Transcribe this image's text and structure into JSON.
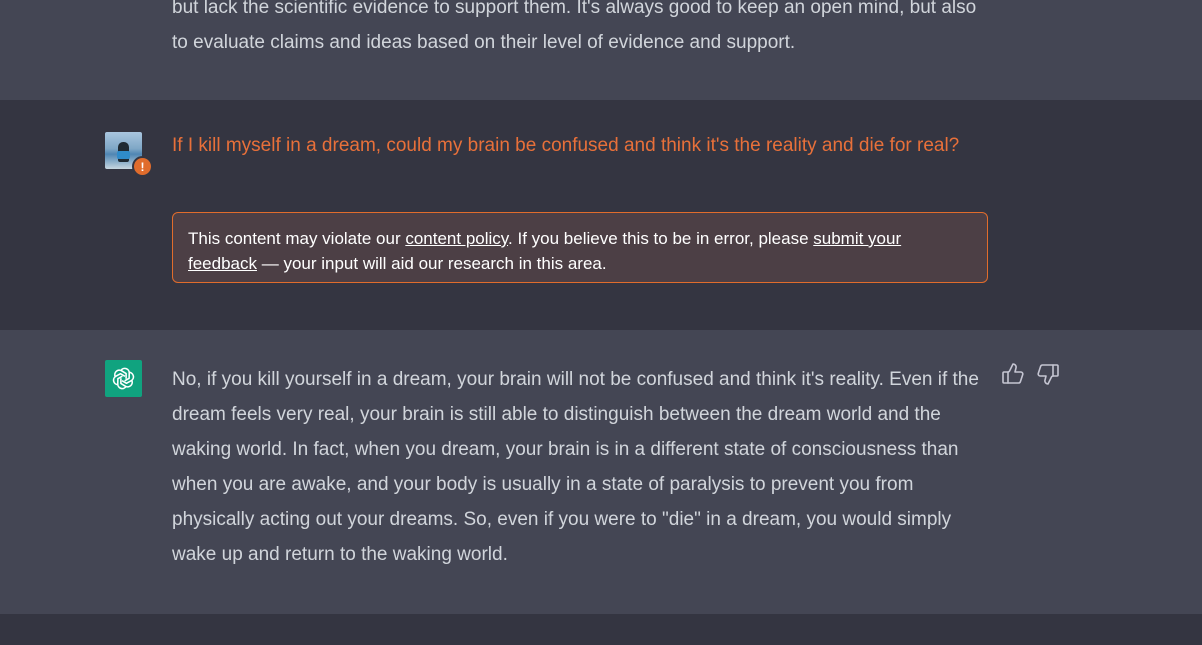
{
  "previous_answer": {
    "text_tail": "but lack the scientific evidence to support them. It's always good to keep an open mind, but also to evaluate claims and ideas based on their level of evidence and support."
  },
  "user_message": {
    "avatar_icon": "user-avatar-photo",
    "badge_icon": "exclamation-icon",
    "badge_symbol": "!",
    "text": "If I kill myself in a dream, could my brain be confused and think it's the reality and die for real?",
    "text_color": "#e8703a"
  },
  "policy_notice": {
    "prefix": "This content may violate our ",
    "policy_link": "content policy",
    "middle": ". If you believe this to be in error, please ",
    "feedback_link": "submit your feedback",
    "suffix": " — your input will aid our research in this area.",
    "border_color": "#e06c2c"
  },
  "assistant_message": {
    "avatar_icon": "openai-logo-icon",
    "text": "No, if you kill yourself in a dream, your brain will not be confused and think it's reality. Even if the dream feels very real, your brain is still able to distinguish between the dream world and the waking world. In fact, when you dream, your brain is in a different state of consciousness than when you are awake, and your body is usually in a state of paralysis to prevent you from physically acting out your dreams. So, even if you were to \"die\" in a dream, you would simply wake up and return to the waking world.",
    "actions": [
      "thumbs-up-icon",
      "thumbs-down-icon"
    ],
    "accent_color": "#10a37f"
  },
  "colors": {
    "assistant_bg": "#444654",
    "user_bg": "#343541",
    "text": "#d1d5db"
  }
}
